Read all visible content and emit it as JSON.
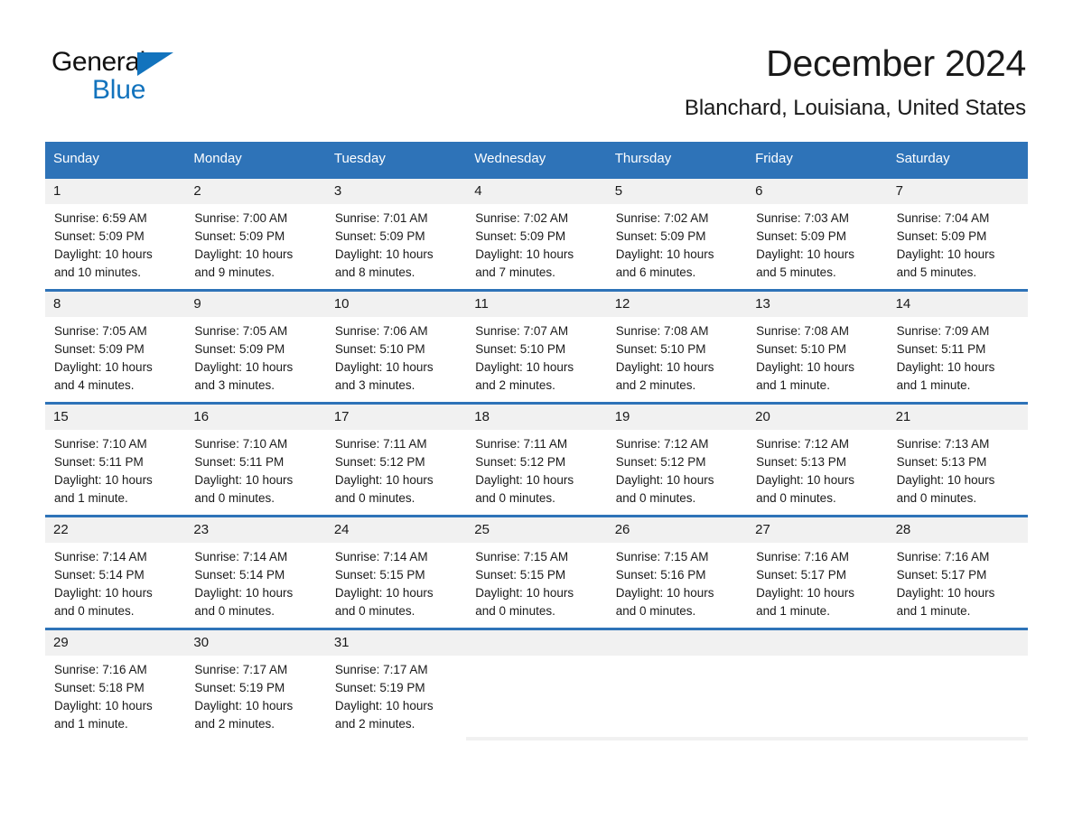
{
  "logo": {
    "word1": "General",
    "word2": "Blue",
    "triangle_color": "#1273bd"
  },
  "header": {
    "title": "December 2024",
    "subtitle": "Blanchard, Louisiana, United States"
  },
  "theme": {
    "header_blue": "#2e73b8",
    "row_divider_blue": "#2e73b8",
    "daynum_band": "#f1f1f1",
    "text": "#1a1a1a"
  },
  "weekday_headers": [
    "Sunday",
    "Monday",
    "Tuesday",
    "Wednesday",
    "Thursday",
    "Friday",
    "Saturday"
  ],
  "weeks": [
    {
      "days": [
        {
          "num": "1",
          "sunrise": "Sunrise: 6:59 AM",
          "sunset": "Sunset: 5:09 PM",
          "daylight1": "Daylight: 10 hours",
          "daylight2": "and 10 minutes."
        },
        {
          "num": "2",
          "sunrise": "Sunrise: 7:00 AM",
          "sunset": "Sunset: 5:09 PM",
          "daylight1": "Daylight: 10 hours",
          "daylight2": "and 9 minutes."
        },
        {
          "num": "3",
          "sunrise": "Sunrise: 7:01 AM",
          "sunset": "Sunset: 5:09 PM",
          "daylight1": "Daylight: 10 hours",
          "daylight2": "and 8 minutes."
        },
        {
          "num": "4",
          "sunrise": "Sunrise: 7:02 AM",
          "sunset": "Sunset: 5:09 PM",
          "daylight1": "Daylight: 10 hours",
          "daylight2": "and 7 minutes."
        },
        {
          "num": "5",
          "sunrise": "Sunrise: 7:02 AM",
          "sunset": "Sunset: 5:09 PM",
          "daylight1": "Daylight: 10 hours",
          "daylight2": "and 6 minutes."
        },
        {
          "num": "6",
          "sunrise": "Sunrise: 7:03 AM",
          "sunset": "Sunset: 5:09 PM",
          "daylight1": "Daylight: 10 hours",
          "daylight2": "and 5 minutes."
        },
        {
          "num": "7",
          "sunrise": "Sunrise: 7:04 AM",
          "sunset": "Sunset: 5:09 PM",
          "daylight1": "Daylight: 10 hours",
          "daylight2": "and 5 minutes."
        }
      ]
    },
    {
      "days": [
        {
          "num": "8",
          "sunrise": "Sunrise: 7:05 AM",
          "sunset": "Sunset: 5:09 PM",
          "daylight1": "Daylight: 10 hours",
          "daylight2": "and 4 minutes."
        },
        {
          "num": "9",
          "sunrise": "Sunrise: 7:05 AM",
          "sunset": "Sunset: 5:09 PM",
          "daylight1": "Daylight: 10 hours",
          "daylight2": "and 3 minutes."
        },
        {
          "num": "10",
          "sunrise": "Sunrise: 7:06 AM",
          "sunset": "Sunset: 5:10 PM",
          "daylight1": "Daylight: 10 hours",
          "daylight2": "and 3 minutes."
        },
        {
          "num": "11",
          "sunrise": "Sunrise: 7:07 AM",
          "sunset": "Sunset: 5:10 PM",
          "daylight1": "Daylight: 10 hours",
          "daylight2": "and 2 minutes."
        },
        {
          "num": "12",
          "sunrise": "Sunrise: 7:08 AM",
          "sunset": "Sunset: 5:10 PM",
          "daylight1": "Daylight: 10 hours",
          "daylight2": "and 2 minutes."
        },
        {
          "num": "13",
          "sunrise": "Sunrise: 7:08 AM",
          "sunset": "Sunset: 5:10 PM",
          "daylight1": "Daylight: 10 hours",
          "daylight2": "and 1 minute."
        },
        {
          "num": "14",
          "sunrise": "Sunrise: 7:09 AM",
          "sunset": "Sunset: 5:11 PM",
          "daylight1": "Daylight: 10 hours",
          "daylight2": "and 1 minute."
        }
      ]
    },
    {
      "days": [
        {
          "num": "15",
          "sunrise": "Sunrise: 7:10 AM",
          "sunset": "Sunset: 5:11 PM",
          "daylight1": "Daylight: 10 hours",
          "daylight2": "and 1 minute."
        },
        {
          "num": "16",
          "sunrise": "Sunrise: 7:10 AM",
          "sunset": "Sunset: 5:11 PM",
          "daylight1": "Daylight: 10 hours",
          "daylight2": "and 0 minutes."
        },
        {
          "num": "17",
          "sunrise": "Sunrise: 7:11 AM",
          "sunset": "Sunset: 5:12 PM",
          "daylight1": "Daylight: 10 hours",
          "daylight2": "and 0 minutes."
        },
        {
          "num": "18",
          "sunrise": "Sunrise: 7:11 AM",
          "sunset": "Sunset: 5:12 PM",
          "daylight1": "Daylight: 10 hours",
          "daylight2": "and 0 minutes."
        },
        {
          "num": "19",
          "sunrise": "Sunrise: 7:12 AM",
          "sunset": "Sunset: 5:12 PM",
          "daylight1": "Daylight: 10 hours",
          "daylight2": "and 0 minutes."
        },
        {
          "num": "20",
          "sunrise": "Sunrise: 7:12 AM",
          "sunset": "Sunset: 5:13 PM",
          "daylight1": "Daylight: 10 hours",
          "daylight2": "and 0 minutes."
        },
        {
          "num": "21",
          "sunrise": "Sunrise: 7:13 AM",
          "sunset": "Sunset: 5:13 PM",
          "daylight1": "Daylight: 10 hours",
          "daylight2": "and 0 minutes."
        }
      ]
    },
    {
      "days": [
        {
          "num": "22",
          "sunrise": "Sunrise: 7:14 AM",
          "sunset": "Sunset: 5:14 PM",
          "daylight1": "Daylight: 10 hours",
          "daylight2": "and 0 minutes."
        },
        {
          "num": "23",
          "sunrise": "Sunrise: 7:14 AM",
          "sunset": "Sunset: 5:14 PM",
          "daylight1": "Daylight: 10 hours",
          "daylight2": "and 0 minutes."
        },
        {
          "num": "24",
          "sunrise": "Sunrise: 7:14 AM",
          "sunset": "Sunset: 5:15 PM",
          "daylight1": "Daylight: 10 hours",
          "daylight2": "and 0 minutes."
        },
        {
          "num": "25",
          "sunrise": "Sunrise: 7:15 AM",
          "sunset": "Sunset: 5:15 PM",
          "daylight1": "Daylight: 10 hours",
          "daylight2": "and 0 minutes."
        },
        {
          "num": "26",
          "sunrise": "Sunrise: 7:15 AM",
          "sunset": "Sunset: 5:16 PM",
          "daylight1": "Daylight: 10 hours",
          "daylight2": "and 0 minutes."
        },
        {
          "num": "27",
          "sunrise": "Sunrise: 7:16 AM",
          "sunset": "Sunset: 5:17 PM",
          "daylight1": "Daylight: 10 hours",
          "daylight2": "and 1 minute."
        },
        {
          "num": "28",
          "sunrise": "Sunrise: 7:16 AM",
          "sunset": "Sunset: 5:17 PM",
          "daylight1": "Daylight: 10 hours",
          "daylight2": "and 1 minute."
        }
      ]
    },
    {
      "days": [
        {
          "num": "29",
          "sunrise": "Sunrise: 7:16 AM",
          "sunset": "Sunset: 5:18 PM",
          "daylight1": "Daylight: 10 hours",
          "daylight2": "and 1 minute."
        },
        {
          "num": "30",
          "sunrise": "Sunrise: 7:17 AM",
          "sunset": "Sunset: 5:19 PM",
          "daylight1": "Daylight: 10 hours",
          "daylight2": "and 2 minutes."
        },
        {
          "num": "31",
          "sunrise": "Sunrise: 7:17 AM",
          "sunset": "Sunset: 5:19 PM",
          "daylight1": "Daylight: 10 hours",
          "daylight2": "and 2 minutes."
        },
        {
          "num": "",
          "sunrise": "",
          "sunset": "",
          "daylight1": "",
          "daylight2": ""
        },
        {
          "num": "",
          "sunrise": "",
          "sunset": "",
          "daylight1": "",
          "daylight2": ""
        },
        {
          "num": "",
          "sunrise": "",
          "sunset": "",
          "daylight1": "",
          "daylight2": ""
        },
        {
          "num": "",
          "sunrise": "",
          "sunset": "",
          "daylight1": "",
          "daylight2": ""
        }
      ]
    }
  ]
}
